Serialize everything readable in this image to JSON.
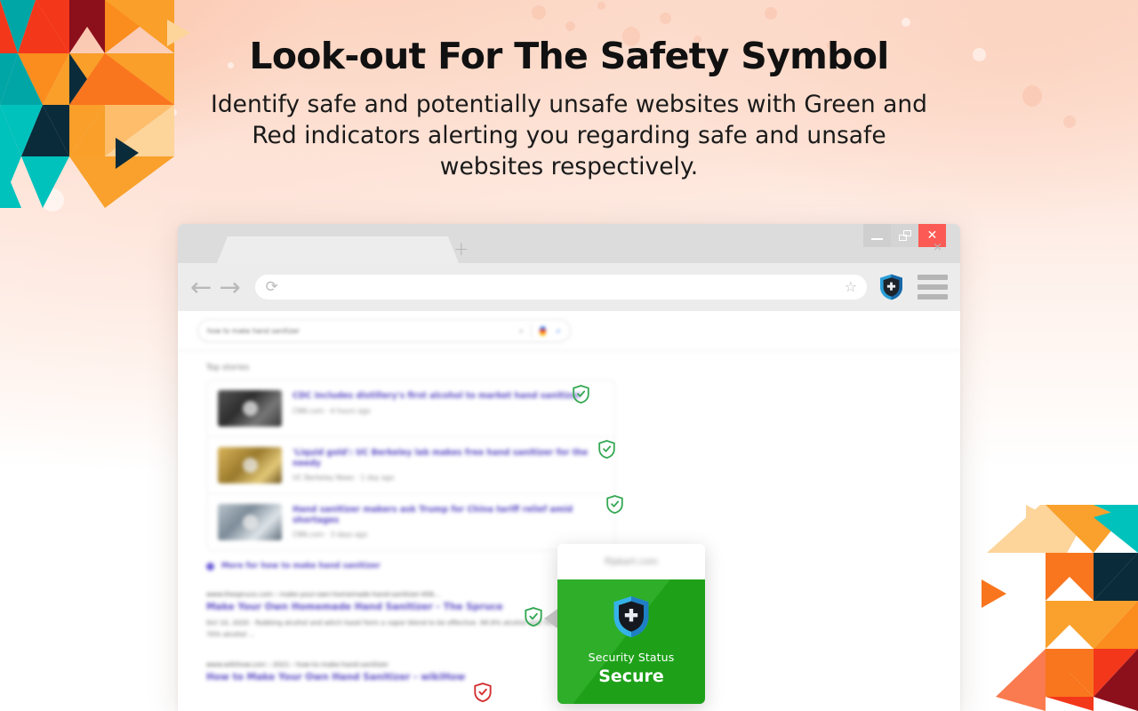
{
  "header": {
    "title": "Look-out For The Safety Symbol",
    "subtitle": "Identify safe and potentially unsafe websites with Green and Red indicators alerting you regarding safe and unsafe websites respectively."
  },
  "browser": {
    "window_controls": {
      "minimize_label": "—",
      "restore_label": "❐",
      "close_label": "✕"
    },
    "tab": {
      "title": "",
      "close_label": "×"
    },
    "new_tab_label": "+",
    "toolbar": {
      "back_label": "←",
      "forward_label": "→",
      "reload_label": "⟳",
      "address_value": "",
      "address_placeholder": "",
      "bookmark_label": "☆",
      "extension_icon_name": "shield-icon",
      "menu_label": ""
    }
  },
  "page": {
    "search": {
      "query": "how to make hand sanitizer",
      "clear_label": "×",
      "mic_icon_name": "microphone-icon",
      "submit_label": "⌕"
    },
    "top_stories_label": "Top stories",
    "stories": [
      {
        "title": "CDC includes distillery's first alcohol to market hand sanitizer",
        "meta": "CNN.com  ·  4 hours ago",
        "badge": "safe"
      },
      {
        "title": "'Liquid gold': UC Berkeley lab makes free hand sanitizer for the needy",
        "meta": "UC Berkeley News  ·  1 day ago",
        "badge": "safe"
      },
      {
        "title": "Hand sanitizer makers ask Trump for China tariff relief amid shortages",
        "meta": "CNN.com  ·  3 days ago",
        "badge": "safe"
      }
    ],
    "more_news_label": "More for how to make hand sanitizer",
    "results": [
      {
        "url": "www.thespruce.com › make-your-own-homemade-hand-sanitizer-456...",
        "title": "Make Your Own Homemade Hand Sanitizer - The Spruce",
        "snippet": "Oct 10, 2020 · Rubbing alcohol and witch hazel form a vapor blend to be effective. 99.9% alcohol and 70% alcohol. You can disinfect your hands with 70% alcohol ...",
        "badge": "safe"
      },
      {
        "url": "www.wikihow.com › 2021 › how-to-make-hand-sanitizer",
        "title": "How to Make Your Own Hand Sanitizer - wikiHow",
        "snippet": "",
        "badge": "unsafe"
      }
    ]
  },
  "security_popup": {
    "domain": "flipkart.com",
    "status_label": "Security Status",
    "status_value": "Secure",
    "status_color": "#1fa81a",
    "shield_icon_name": "shield-plus-icon"
  },
  "colors": {
    "safe_green": "#34a853",
    "unsafe_red": "#d32f2f",
    "close_red": "#fb5b54",
    "link_purple": "#5b4bc4",
    "mosaic_orange": "#f99f2a",
    "mosaic_orange_deep": "#f9761e",
    "mosaic_teal": "#00c2bd",
    "mosaic_navy": "#0a2b3a",
    "mosaic_red": "#f3371b",
    "mosaic_maroon": "#8c0f1c"
  }
}
